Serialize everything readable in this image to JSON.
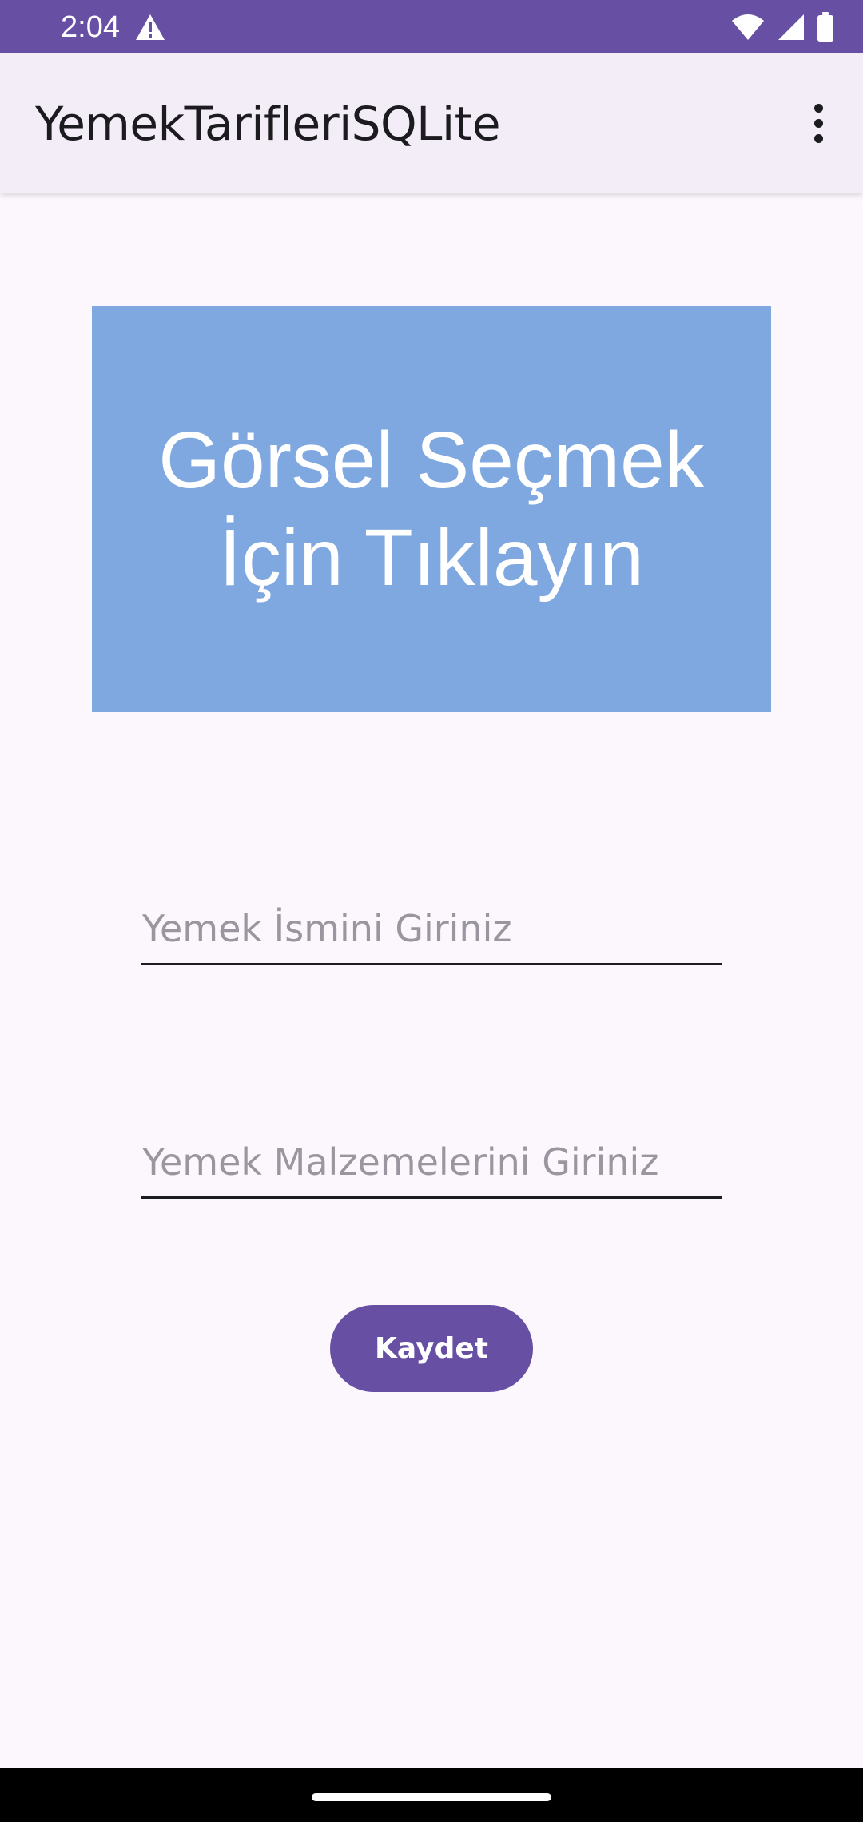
{
  "status_bar": {
    "time": "2:04",
    "icons": [
      "warning-icon",
      "wifi-icon",
      "signal-icon",
      "battery-icon"
    ],
    "background": "#6750A4"
  },
  "app_bar": {
    "title": "YemekTarifleriSQLite",
    "menu_icon": "more-vert-icon"
  },
  "image_picker": {
    "line1": "Görsel Seçmek",
    "line2": "İçin Tıklayın",
    "background": "#7FA8E0"
  },
  "form": {
    "name_placeholder": "Yemek İsmini Giriniz",
    "name_value": "",
    "ingredients_placeholder": "Yemek Malzemelerini Giriniz",
    "ingredients_value": "",
    "save_label": "Kaydet"
  },
  "colors": {
    "primary": "#6750A4",
    "surface": "#FCF7FC",
    "app_bar": "#F2EDF6"
  }
}
